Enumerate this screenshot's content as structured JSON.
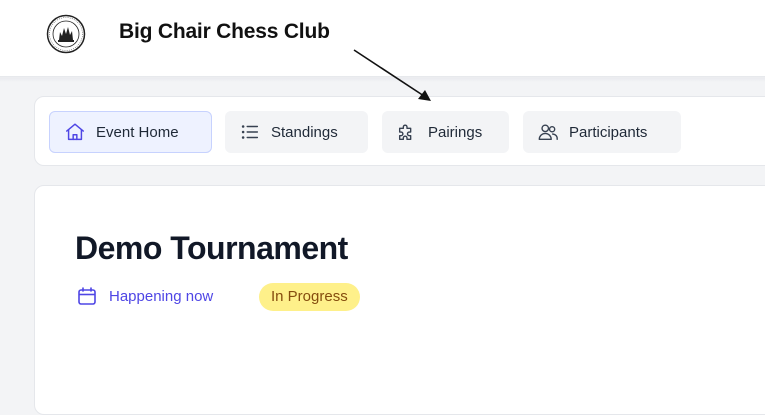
{
  "header": {
    "club_name": "Big Chair Chess Club",
    "logo_icon": "club-seal-logo"
  },
  "nav": {
    "tabs": [
      {
        "label": "Event Home",
        "icon": "home-icon",
        "active": true
      },
      {
        "label": "Standings",
        "icon": "list-icon",
        "active": false
      },
      {
        "label": "Pairings",
        "icon": "puzzle-icon",
        "active": false
      },
      {
        "label": "Participants",
        "icon": "users-icon",
        "active": false
      }
    ]
  },
  "event": {
    "title": "Demo Tournament",
    "date_text": "Happening now",
    "date_icon": "calendar-icon",
    "status": "In Progress"
  },
  "colors": {
    "accent": "#4f46e5",
    "active_tab_bg": "#eef2ff",
    "badge_bg": "#fef08a",
    "badge_text": "#854d0e"
  }
}
